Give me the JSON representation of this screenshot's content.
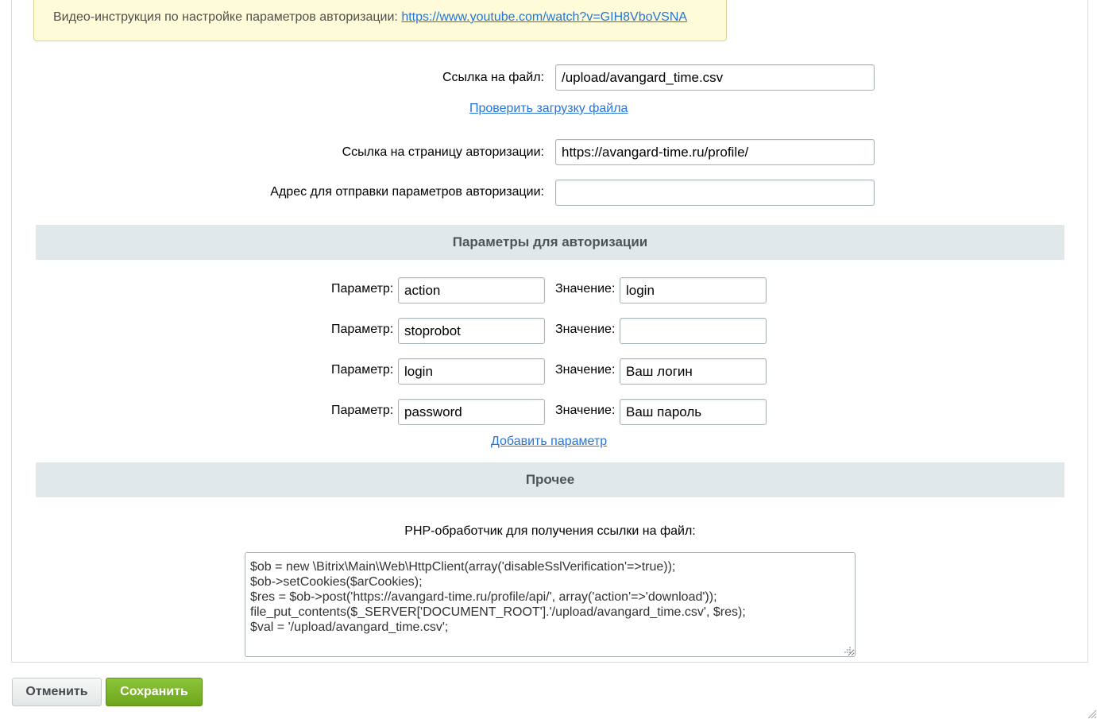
{
  "notice": {
    "text": "Видео-инструкция по настройке параметров авторизации: ",
    "link": "https://www.youtube.com/watch?v=GIH8VboVSNA"
  },
  "file_link": {
    "label": "Ссылка на файл:",
    "value": "/upload/avangard_time.csv",
    "check_link": "Проверить загрузку файла"
  },
  "auth_page": {
    "label": "Ссылка на страницу авторизации:",
    "value": "https://avangard-time.ru/profile/"
  },
  "auth_post": {
    "label": "Адрес для отправки параметров авторизации:",
    "value": ""
  },
  "auth_params": {
    "title": "Параметры для авторизации",
    "param_label": "Параметр:",
    "value_label": "Значение:",
    "rows": [
      {
        "param": "action",
        "value": "login"
      },
      {
        "param": "stoprobot",
        "value": ""
      },
      {
        "param": "login",
        "value": "Ваш логин"
      },
      {
        "param": "password",
        "value": "Ваш пароль"
      }
    ],
    "add_link": "Добавить параметр"
  },
  "other": {
    "title": "Прочее",
    "php_label": "PHP-обработчик для получения ссылки на файл:",
    "php_code": "$ob = new \\Bitrix\\Main\\Web\\HttpClient(array('disableSslVerification'=>true));\n$ob->setCookies($arCookies);\n$res = $ob->post('https://avangard-time.ru/profile/api/', array('action'=>'download'));\nfile_put_contents($_SERVER['DOCUMENT_ROOT'].'/upload/avangard_time.csv', $res);\n$val = '/upload/avangard_time.csv';"
  },
  "buttons": {
    "cancel": "Отменить",
    "save": "Сохранить"
  },
  "colors": {
    "link": "#2675d7",
    "save_button": "#7ab42a",
    "section_bg": "#e0e8ea",
    "notice_bg": "#fefcd8"
  }
}
